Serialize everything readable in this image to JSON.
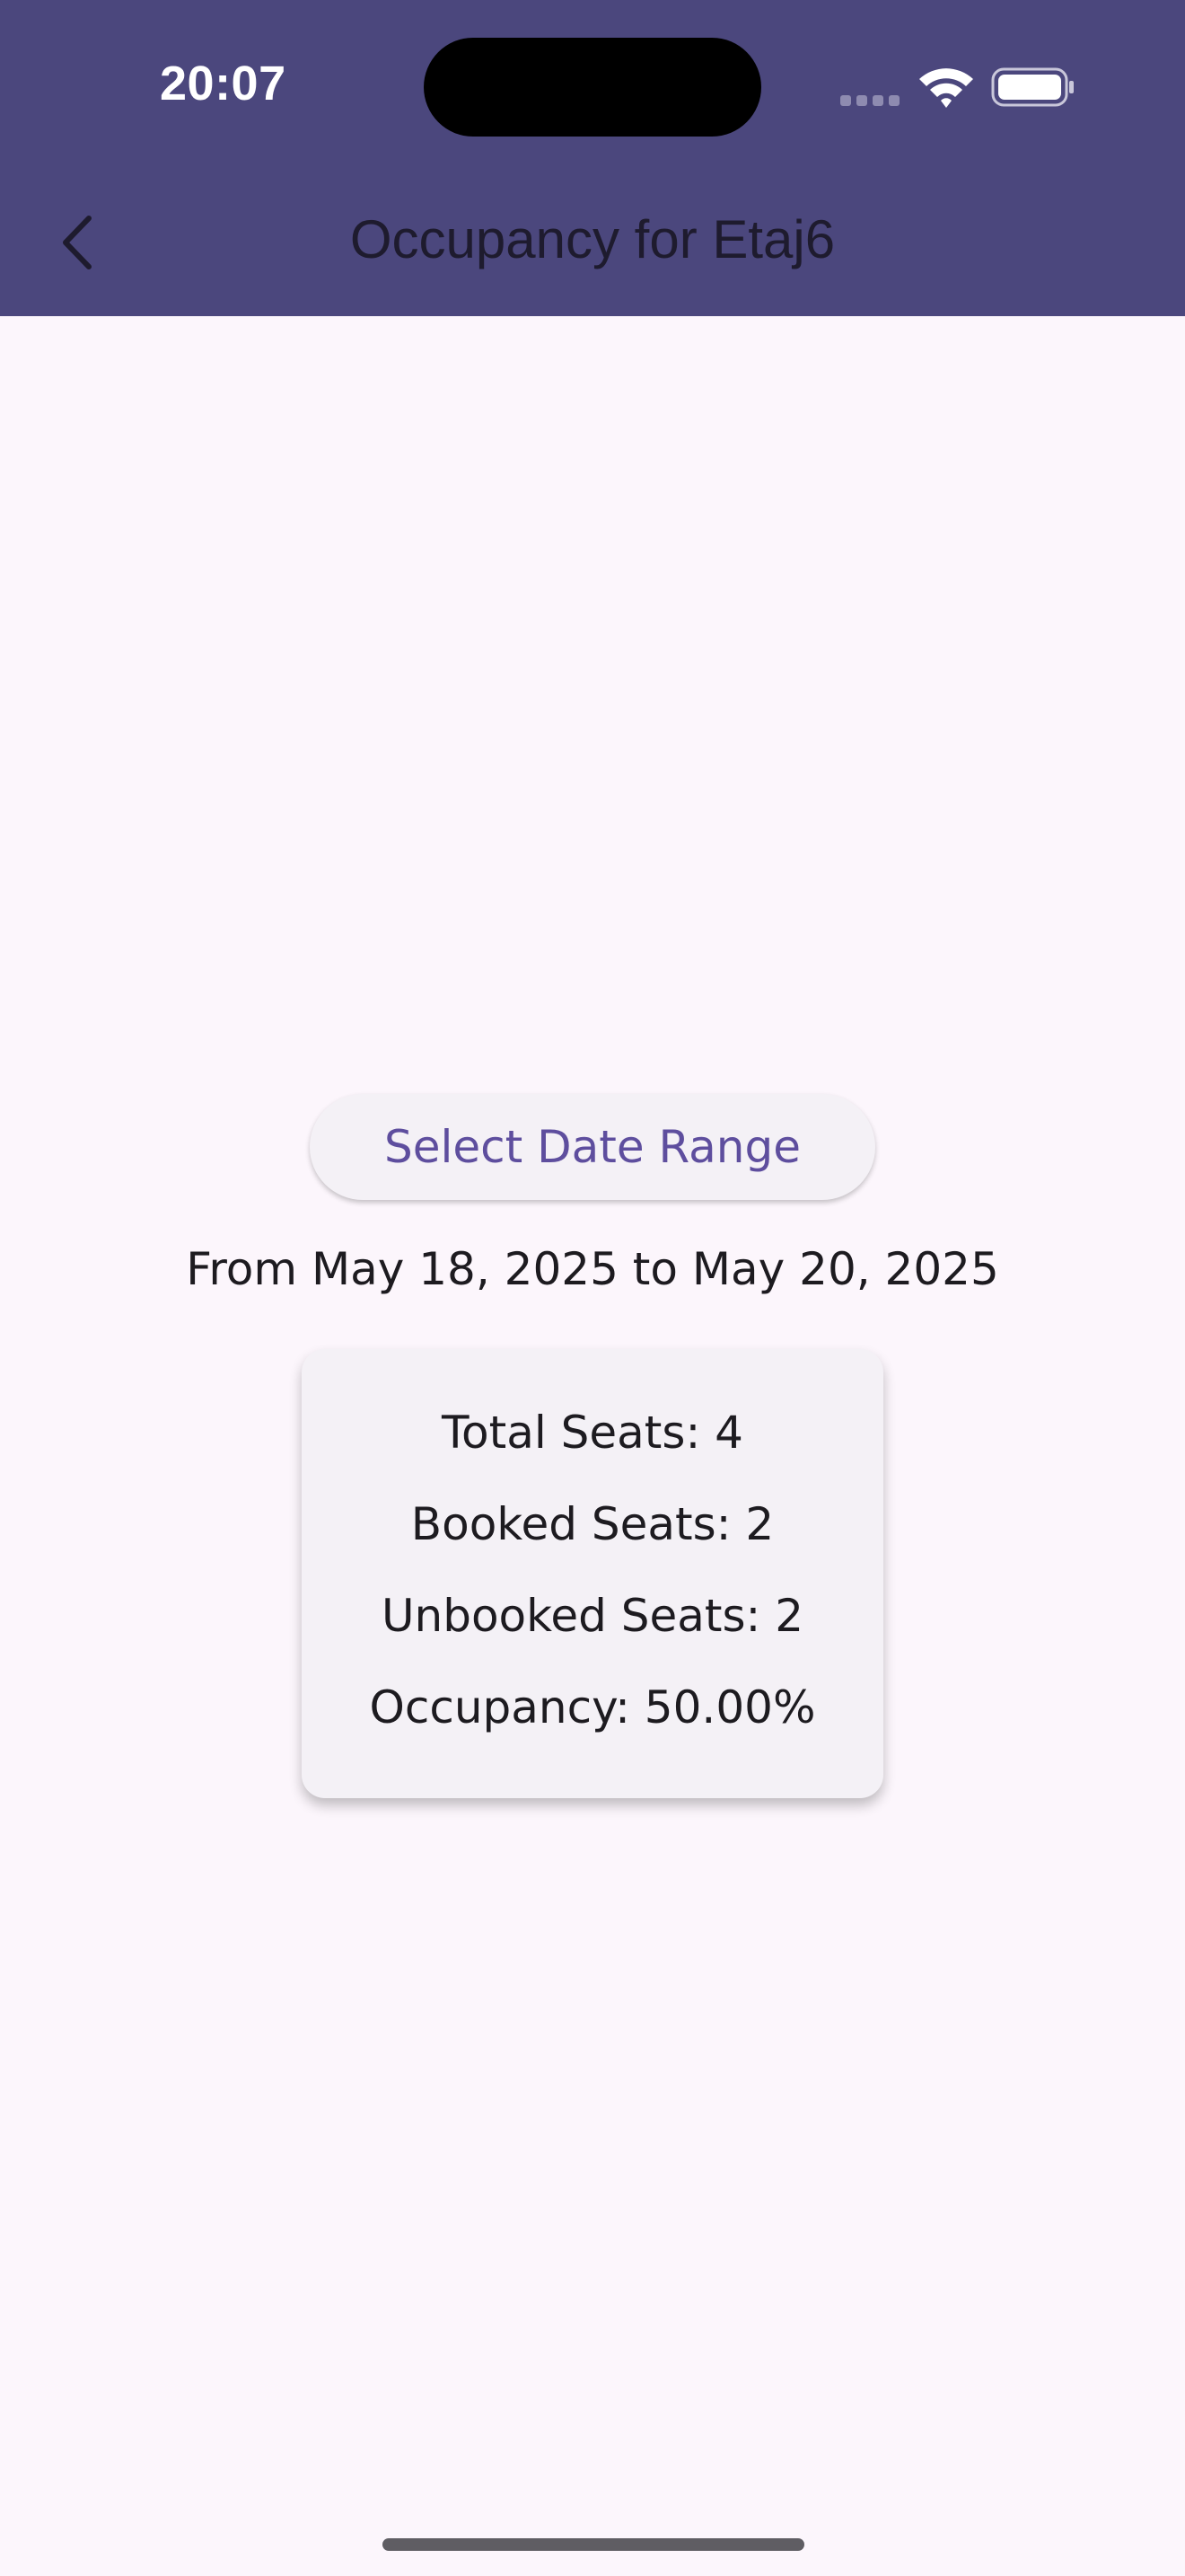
{
  "status_bar": {
    "time": "20:07"
  },
  "app_bar": {
    "title": "Occupancy for Etaj6",
    "back_icon": "chevron-left-icon"
  },
  "main": {
    "select_range_label": "Select Date Range",
    "date_range": "From May 18, 2025 to May 20, 2025",
    "stats": {
      "total_seats": "Total Seats: 4",
      "booked_seats": "Booked Seats: 2",
      "unbooked_seats": "Unbooked Seats: 2",
      "occupancy": "Occupancy: 50.00%"
    }
  },
  "colors": {
    "header": "#4B477D",
    "background": "#FCF6FC",
    "accent": "#5E4E9E",
    "card": "#F4F1F6"
  }
}
